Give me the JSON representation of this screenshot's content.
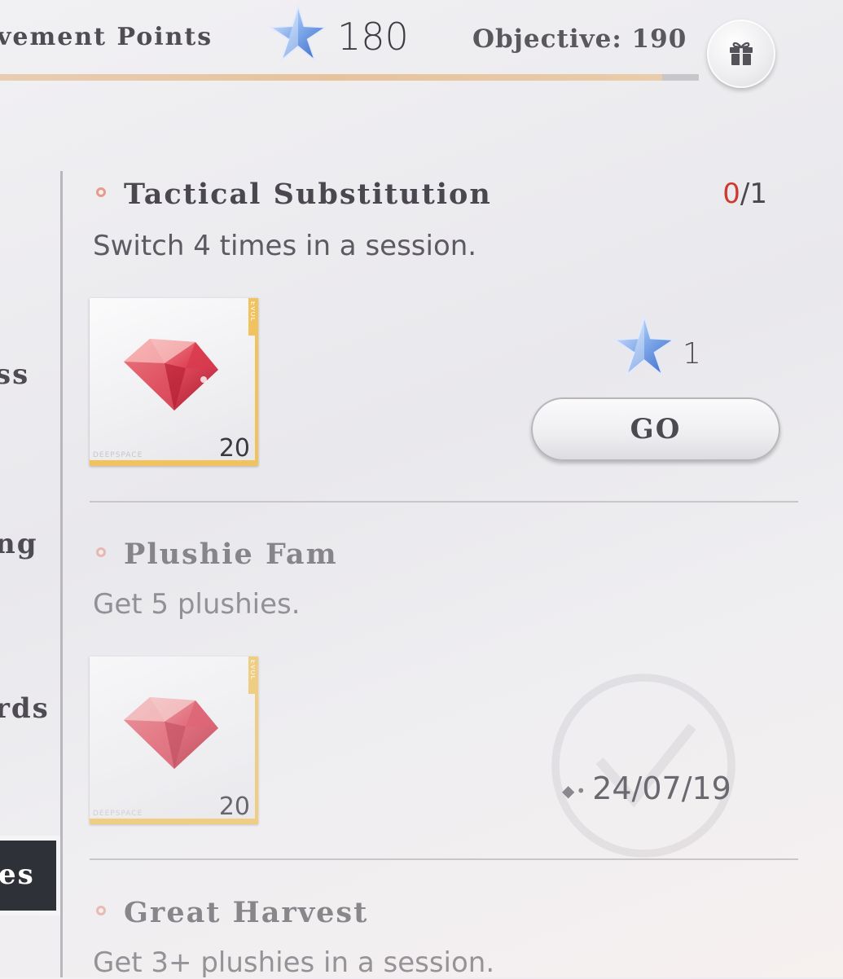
{
  "header": {
    "title": "vement Points",
    "points": "180",
    "objective": "Objective: 190",
    "progress": 0.947
  },
  "left_nav": {
    "items": [
      "ss",
      "ng",
      "rds"
    ],
    "active_label": "es"
  },
  "quests": [
    {
      "title": "Tactical Substitution",
      "description": "Switch 4 times in a session.",
      "progress_current": "0",
      "progress_total": "/1",
      "reward_qty": "20",
      "reward_tag": "EVOL",
      "reward_brand": "DEEPSPACE",
      "star_reward": "1",
      "action": "GO"
    },
    {
      "title": "Plushie Fam",
      "description": "Get 5 plushies.",
      "reward_qty": "20",
      "reward_tag": "EVOL",
      "reward_brand": "DEEPSPACE",
      "completed_date": "24/07/19"
    },
    {
      "title": "Great Harvest",
      "description": "Get 3+ plushies in a session."
    }
  ],
  "colors": {
    "progress_fill": "#e7c39c",
    "counter_current": "#cf3a30",
    "reward_border": "#f0c35e",
    "active_nav": "#2f3138"
  }
}
